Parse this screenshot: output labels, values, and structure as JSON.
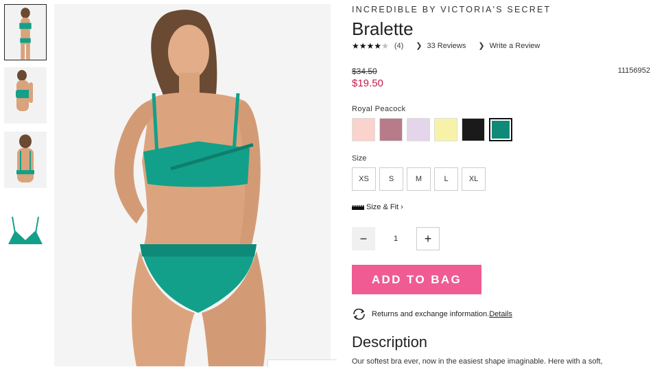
{
  "product": {
    "brand": "INCREDIBLE BY VICTORIA'S SECRET",
    "title": "Bralette",
    "rating_value": 4,
    "rating_count": "(4)",
    "reviews_link": "33 Reviews",
    "write_review_link": "Write a Review",
    "original_price": "$34.50",
    "sale_price": "$19.50",
    "sku": "11156952"
  },
  "colors": {
    "label": "Royal Peacock",
    "swatches": [
      {
        "name": "swatch-blush",
        "hex": "#f9d3cc"
      },
      {
        "name": "swatch-mauve",
        "hex": "#b87b89"
      },
      {
        "name": "swatch-lavender",
        "hex": "#e4d5ea"
      },
      {
        "name": "swatch-yellow",
        "hex": "#f8f2a8"
      },
      {
        "name": "swatch-black",
        "hex": "#1a1a1a"
      },
      {
        "name": "swatch-royal-peacock",
        "hex": "#0f8a78",
        "selected": true
      }
    ]
  },
  "sizes": {
    "label": "Size",
    "options": [
      "XS",
      "S",
      "M",
      "L",
      "XL"
    ]
  },
  "size_fit": "Size & Fit",
  "quantity": {
    "value": "1",
    "minus": "−",
    "plus": "+"
  },
  "add_to_bag": "ADD TO BAG",
  "returns": {
    "text": "Returns and exchange information.",
    "link": "Details"
  },
  "description": {
    "title": "Description",
    "text": "Our softest bra ever, now in the easiest shape imaginable. Here with a soft,"
  },
  "accent_colors": {
    "sale": "#c8194b",
    "cta": "#ef5b92",
    "garment": "#13a08a"
  }
}
